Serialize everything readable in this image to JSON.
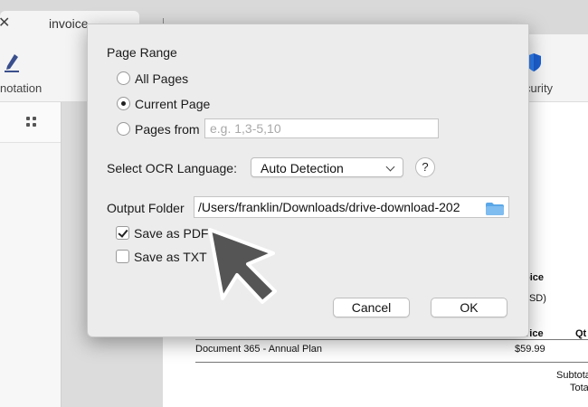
{
  "tab": {
    "close_glyph": "✕",
    "title": "invoice"
  },
  "toolbar": {
    "annotation_label": "notation",
    "security_label": "curity",
    "annotation_icon": "pen-icon",
    "security_icon": "shield-icon",
    "security_color": "#2f7ff2"
  },
  "sidebar": {
    "view_icon": "grid-icon"
  },
  "document": {
    "invoice_heading": "oice",
    "currency_note": "USD)",
    "col_price": "rice",
    "col_qty": "Qt",
    "item_desc": "Document 365 - Annual Plan",
    "item_price": "$59.99",
    "subtotal_label": "Subtota",
    "total_label": "Tota"
  },
  "dialog": {
    "page_range": {
      "title": "Page Range",
      "options": [
        {
          "label": "All Pages",
          "checked": false
        },
        {
          "label": "Current Page",
          "checked": true
        },
        {
          "label": "Pages from",
          "checked": false
        }
      ],
      "pages_placeholder": "e.g. 1,3-5,10",
      "pages_value": ""
    },
    "ocr": {
      "label": "Select OCR Language:",
      "selected": "Auto Detection",
      "help_glyph": "?"
    },
    "output": {
      "label": "Output Folder",
      "path": "/Users/franklin/Downloads/drive-download-202",
      "folder_icon_color": "#5aa7e8"
    },
    "save_options": [
      {
        "label": "Save as PDF",
        "checked": true
      },
      {
        "label": "Save as TXT",
        "checked": false
      }
    ],
    "buttons": {
      "cancel": "Cancel",
      "ok": "OK"
    }
  }
}
